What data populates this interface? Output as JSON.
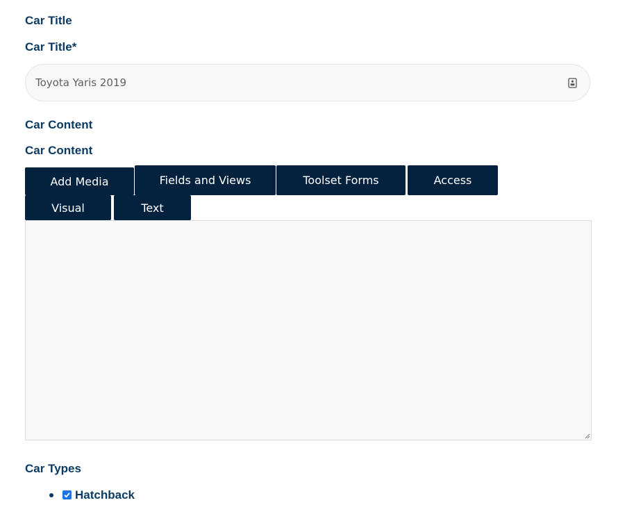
{
  "car_title_section": {
    "heading": "Car Title",
    "field_label": "Car Title*",
    "input_value": "Toyota Yaris 2019"
  },
  "car_content_section": {
    "heading": "Car Content",
    "field_label": "Car Content",
    "toolbar": {
      "add_media": "Add Media",
      "fields_and_views": "Fields and Views",
      "toolset_forms": "Toolset Forms",
      "access": "Access"
    },
    "tabs": {
      "visual": "Visual",
      "text": "Text"
    },
    "editor_value": ""
  },
  "car_types_section": {
    "heading": "Car Types",
    "items": [
      {
        "label": "Hatchback",
        "checked": true
      }
    ]
  },
  "colors": {
    "heading_text": "#0b3a63",
    "button_bg": "#04213e",
    "checkbox_accent": "#1a73e8"
  }
}
